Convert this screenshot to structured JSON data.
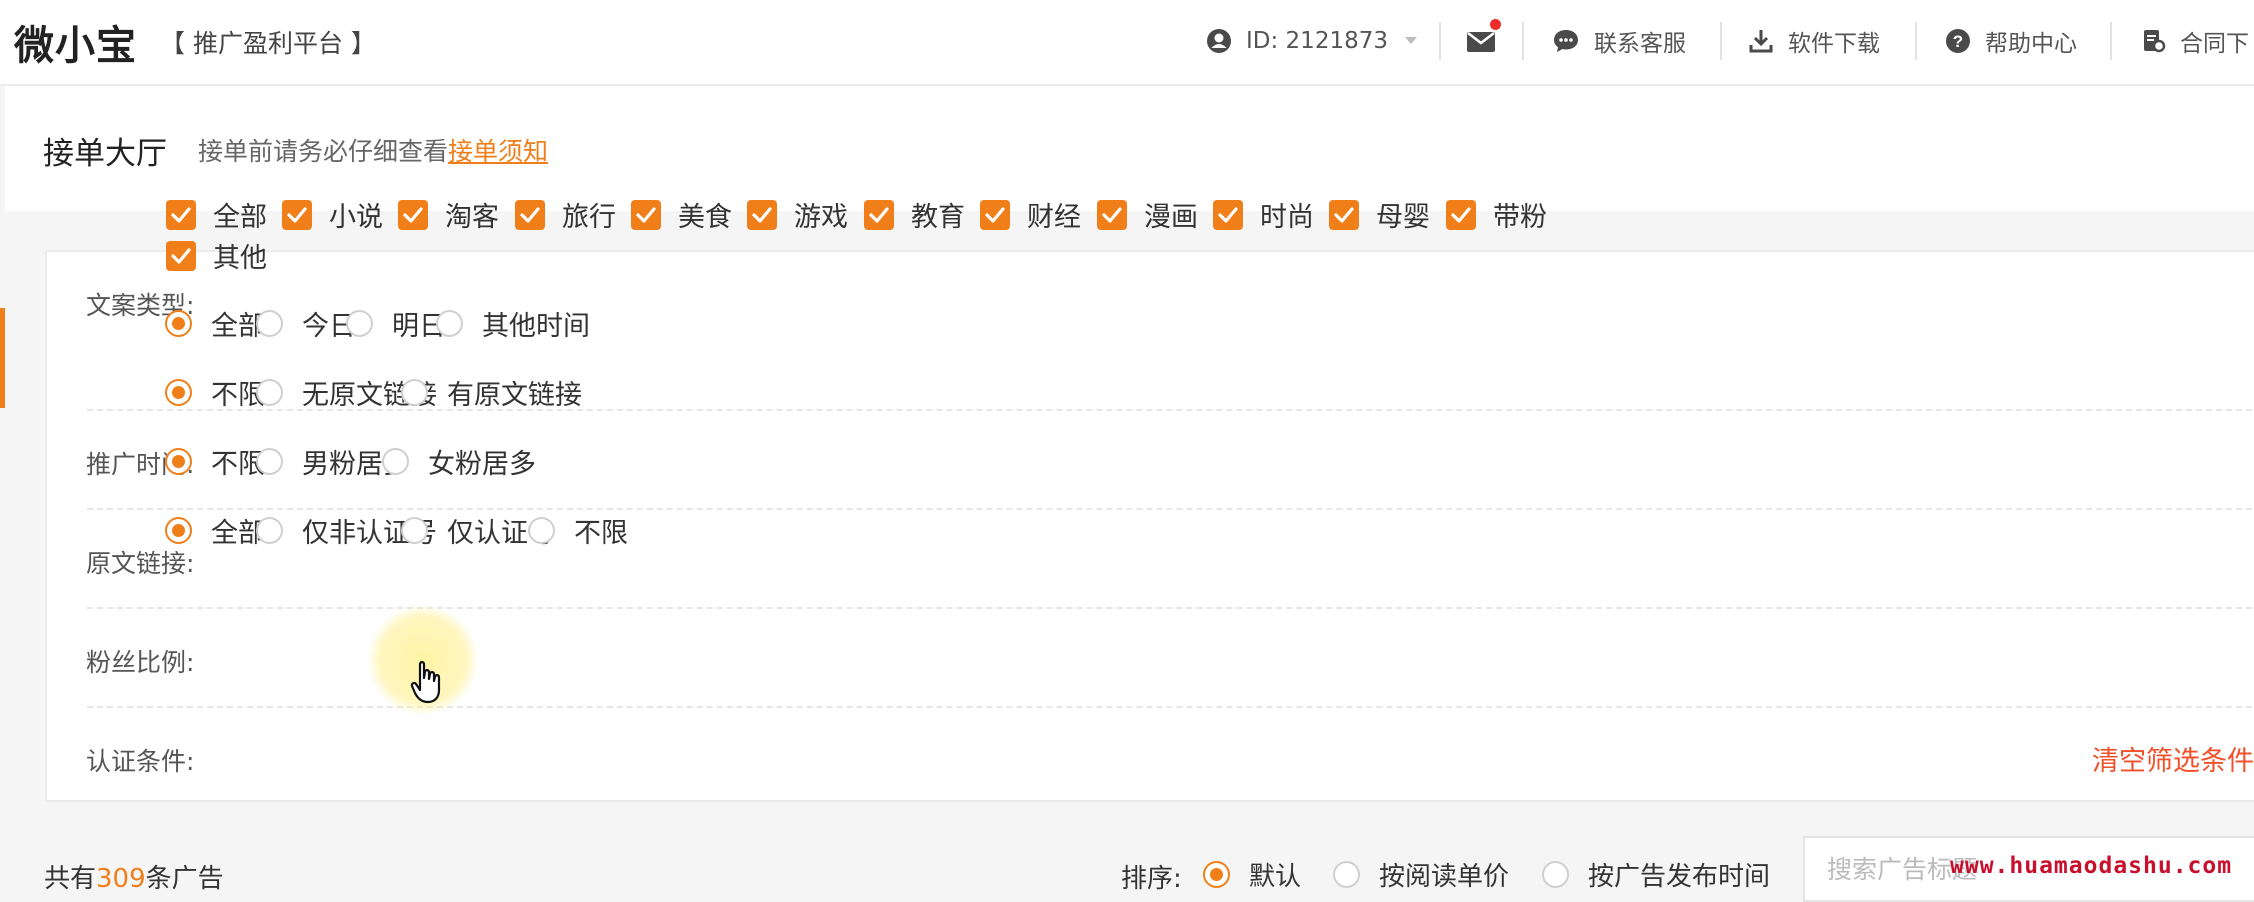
{
  "header": {
    "logo": "微小宝",
    "platform": "【 推广盈利平台 】",
    "user_id": "ID: 2121873",
    "nav": [
      "联系客服",
      "软件下载",
      "帮助中心",
      "合同下"
    ]
  },
  "page": {
    "title": "接单大厅",
    "hint_prefix": "接单前请务必仔细查看",
    "hint_link": "接单须知"
  },
  "filters": {
    "type": {
      "label": "文案类型:",
      "options": [
        "全部",
        "小说",
        "淘客",
        "旅行",
        "美食",
        "游戏",
        "教育",
        "财经",
        "漫画",
        "时尚",
        "母婴",
        "带粉",
        "其他"
      ]
    },
    "time": {
      "label": "推广时间:",
      "options": [
        "全部",
        "今日",
        "明日",
        "其他时间"
      ],
      "selected": "全部"
    },
    "link": {
      "label": "原文链接:",
      "options": [
        "不限",
        "无原文链接",
        "有原文链接"
      ],
      "selected": "不限"
    },
    "fans": {
      "label": "粉丝比例:",
      "options": [
        "不限",
        "男粉居多",
        "女粉居多"
      ],
      "selected": "不限"
    },
    "cert": {
      "label": "认证条件:",
      "options": [
        "全部",
        "仅非认证号",
        "仅认证号",
        "不限"
      ],
      "selected": "全部"
    },
    "clear_label": "清空筛选条件"
  },
  "results": {
    "count_prefix": "共有",
    "count": "309",
    "count_suffix": "条广告",
    "sort_label": "排序:",
    "sort_options": [
      "默认",
      "按阅读单价",
      "按广告发布时间"
    ],
    "sort_selected": "默认",
    "search_placeholder": "搜索广告标题"
  },
  "watermark": "www.huamaodashu.com",
  "colors": {
    "accent": "#f07f1a",
    "danger": "#f0502a",
    "notify_dot": "#f02b2b"
  }
}
